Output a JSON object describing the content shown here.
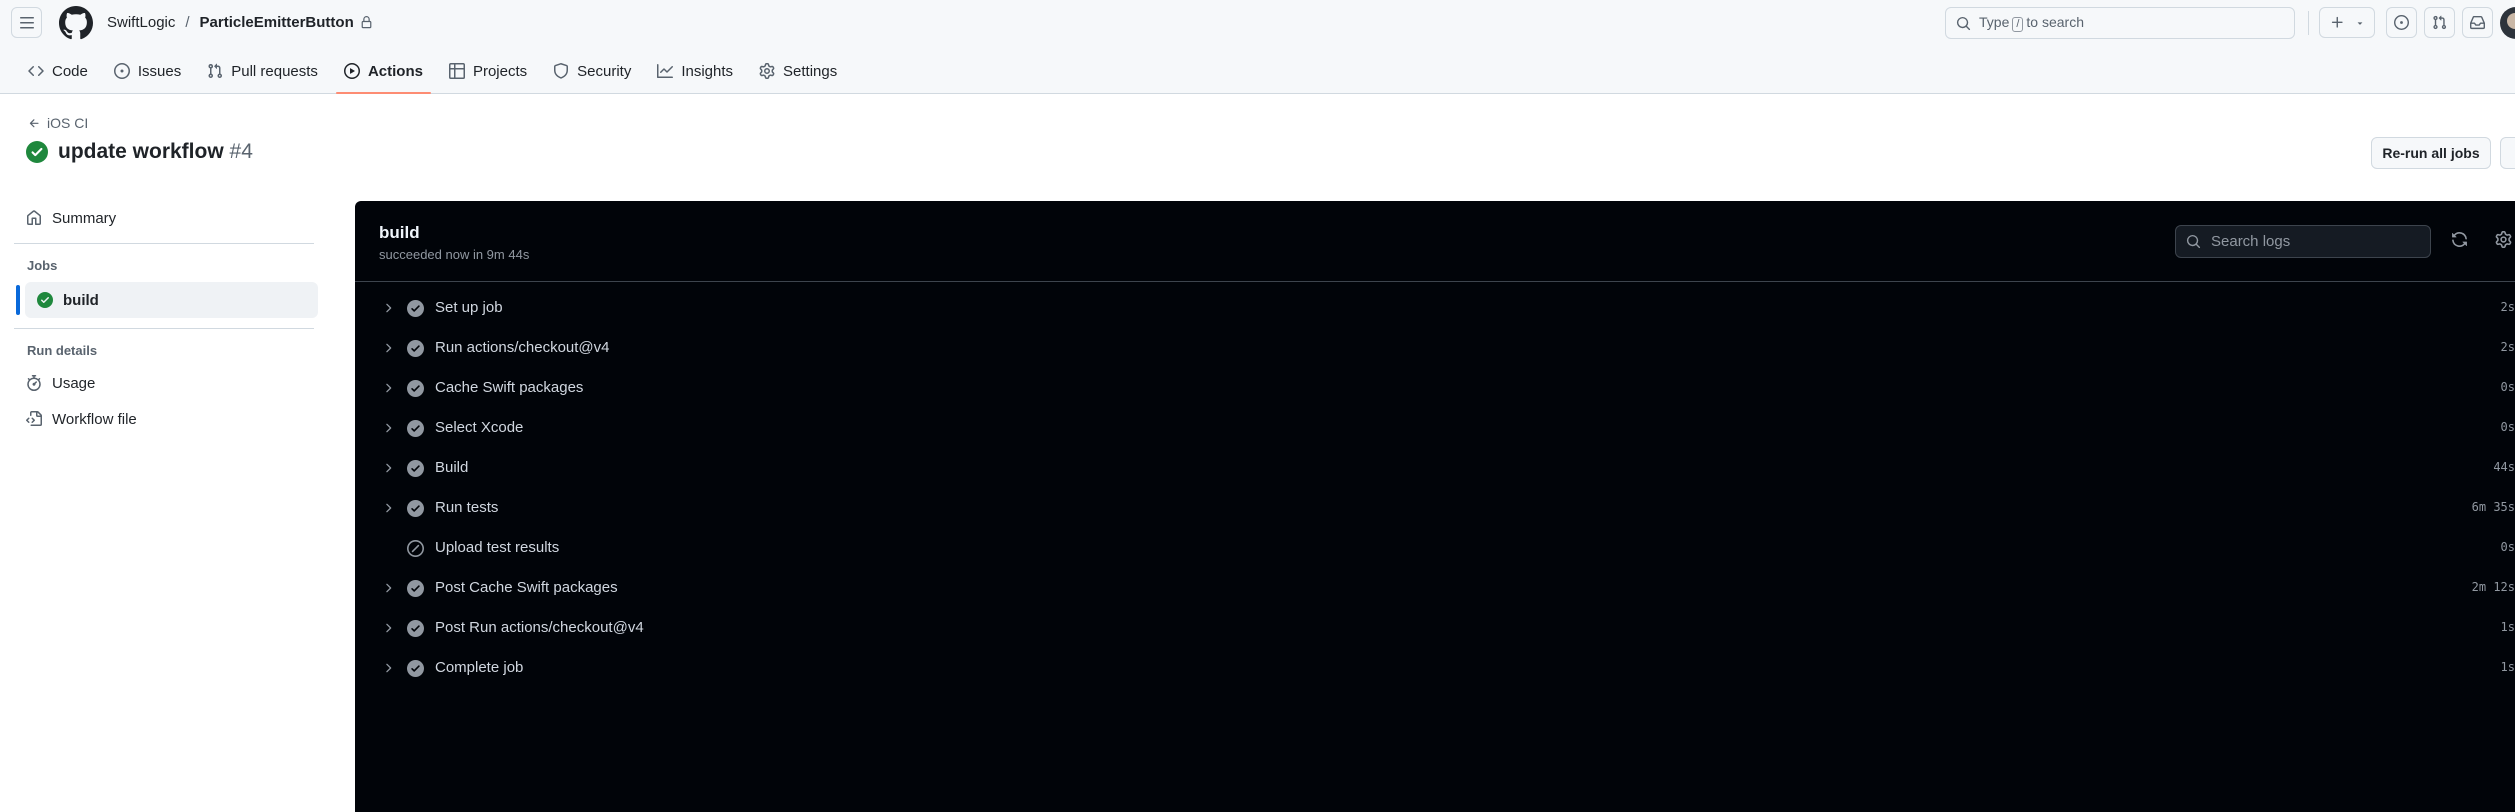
{
  "header": {
    "owner": "SwiftLogic",
    "separator": "/",
    "repo": "ParticleEmitterButton",
    "search_prefix": "Type",
    "search_key": "/",
    "search_suffix": "to search"
  },
  "tabs": [
    {
      "label": "Code",
      "icon": "code-icon"
    },
    {
      "label": "Issues",
      "icon": "issue-opened-icon"
    },
    {
      "label": "Pull requests",
      "icon": "git-pull-request-icon"
    },
    {
      "label": "Actions",
      "icon": "play-icon",
      "active": true
    },
    {
      "label": "Projects",
      "icon": "table-icon"
    },
    {
      "label": "Security",
      "icon": "shield-icon"
    },
    {
      "label": "Insights",
      "icon": "graph-icon"
    },
    {
      "label": "Settings",
      "icon": "gear-icon"
    }
  ],
  "run": {
    "back_label": "iOS CI",
    "title": "update workflow",
    "number": "#4",
    "rerun_label": "Re-run all jobs",
    "more_label": "···"
  },
  "sidebar": {
    "summary": "Summary",
    "jobs_heading": "Jobs",
    "job": "build",
    "run_details_heading": "Run details",
    "usage": "Usage",
    "workflow_file": "Workflow file"
  },
  "log": {
    "title": "build",
    "subtitle": "succeeded now in 9m 44s",
    "search_placeholder": "Search logs",
    "steps": [
      {
        "label": "Set up job",
        "duration": "2s",
        "status": "success"
      },
      {
        "label": "Run actions/checkout@v4",
        "duration": "2s",
        "status": "success"
      },
      {
        "label": "Cache Swift packages",
        "duration": "0s",
        "status": "success"
      },
      {
        "label": "Select Xcode",
        "duration": "0s",
        "status": "success"
      },
      {
        "label": "Build",
        "duration": "44s",
        "status": "success"
      },
      {
        "label": "Run tests",
        "duration": "6m 35s",
        "status": "success"
      },
      {
        "label": "Upload test results",
        "duration": "0s",
        "status": "skipped"
      },
      {
        "label": "Post Cache Swift packages",
        "duration": "2m 12s",
        "status": "success"
      },
      {
        "label": "Post Run actions/checkout@v4",
        "duration": "1s",
        "status": "success"
      },
      {
        "label": "Complete job",
        "duration": "1s",
        "status": "success"
      }
    ]
  },
  "colors": {
    "success": "#1f883d",
    "tab_underline": "#fd8c73",
    "active_marker": "#0969da",
    "log_background": "#010409"
  }
}
